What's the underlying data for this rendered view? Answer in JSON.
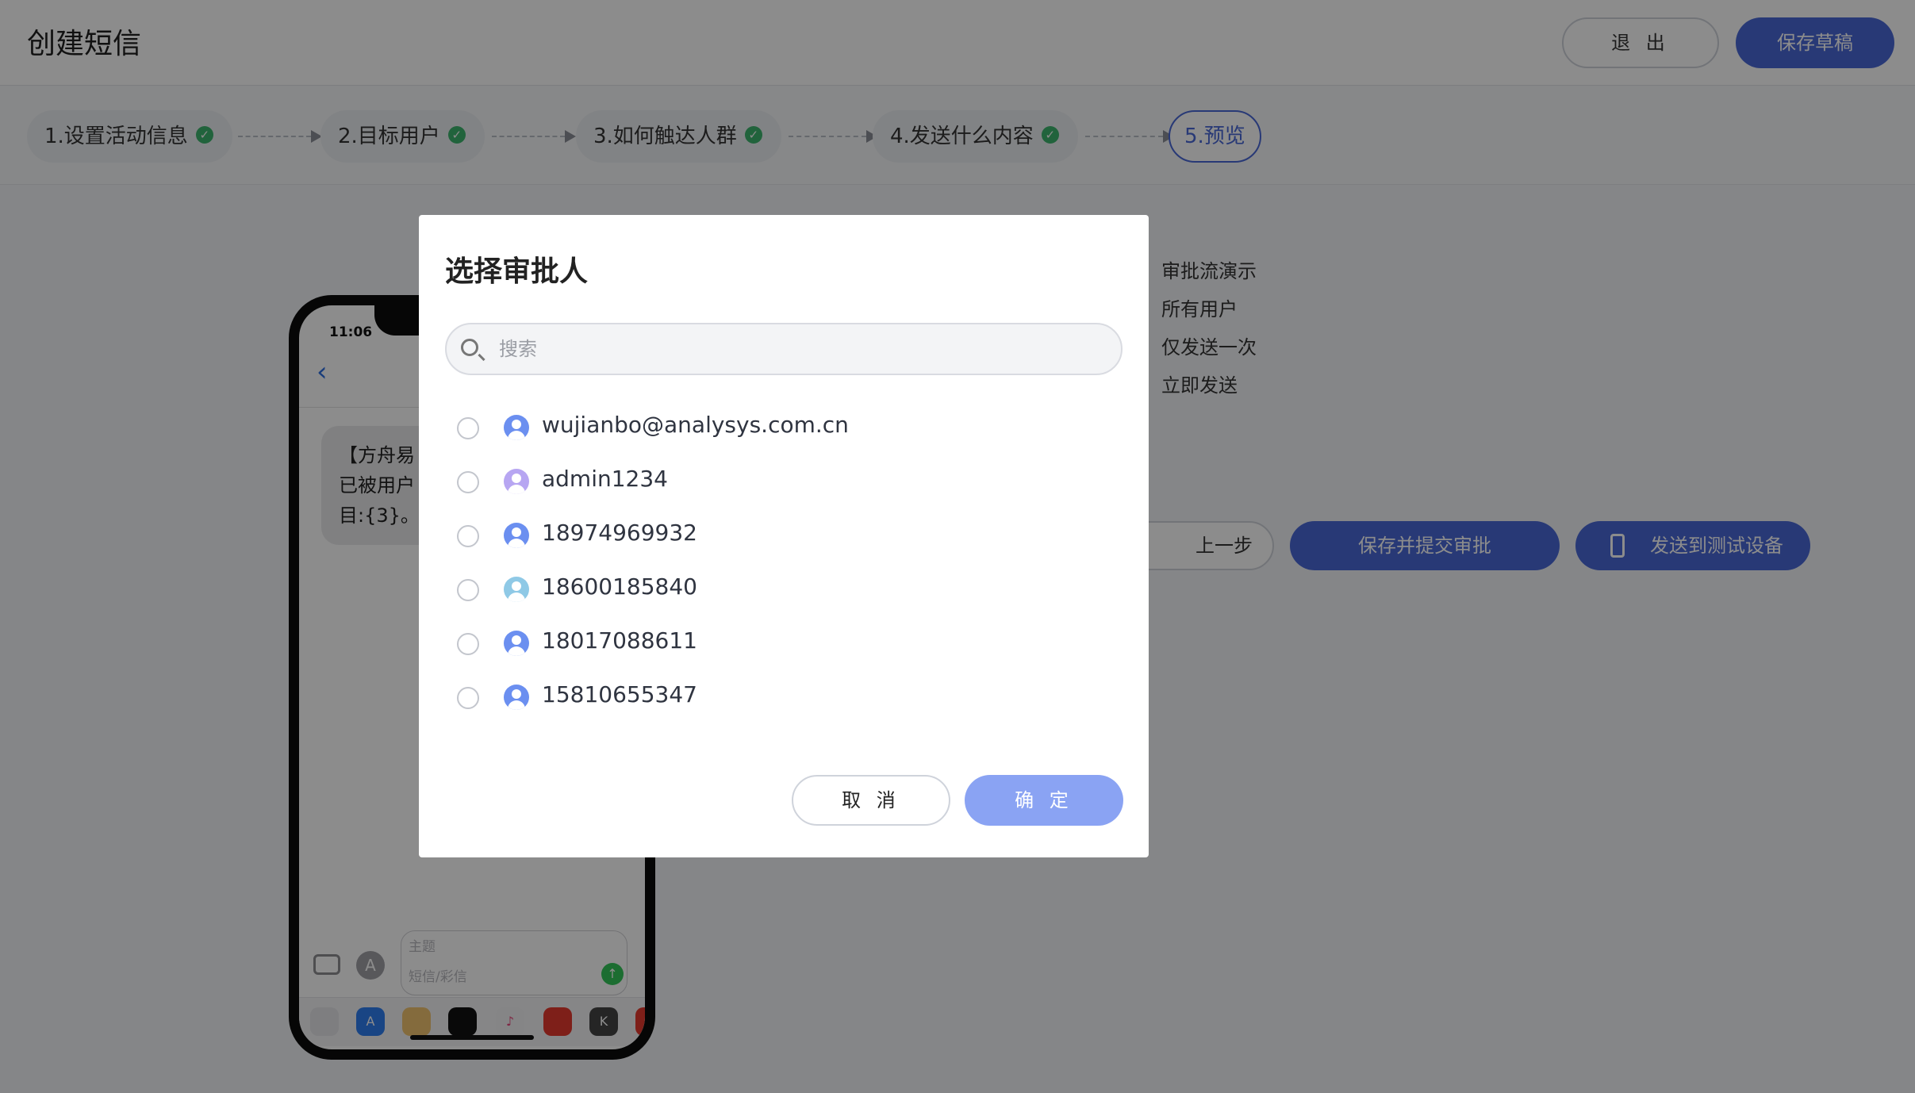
{
  "header": {
    "title": "创建短信",
    "exit_label": "退 出",
    "draft_label": "保存草稿"
  },
  "steps": [
    {
      "label": "1.设置活动信息",
      "done": true
    },
    {
      "label": "2.目标用户",
      "done": true
    },
    {
      "label": "3.如何触达人群",
      "done": true
    },
    {
      "label": "4.发送什么内容",
      "done": true
    },
    {
      "label": "5.预览",
      "done": false,
      "active": true
    }
  ],
  "phone": {
    "time": "11:06",
    "message_lines": [
      "【方舟易",
      "已被用户",
      "目:{3}。"
    ],
    "subject_placeholder": "主题",
    "sms_placeholder": "短信/彩信"
  },
  "summary": {
    "lines": [
      "审批流演示",
      "所有用户",
      "仅发送一次",
      "立即发送"
    ]
  },
  "actions": {
    "prev_label": "上一步",
    "submit_label": "保存并提交审批",
    "test_label": "发送到测试设备"
  },
  "modal": {
    "title": "选择审批人",
    "search_placeholder": "搜索",
    "approvers": [
      {
        "name": "wujianbo@analysys.com.cn",
        "avatar_color": "#6b8ff0"
      },
      {
        "name": "admin1234",
        "avatar_color": "#b7a6f2"
      },
      {
        "name": "18974969932",
        "avatar_color": "#6b8ff0"
      },
      {
        "name": "18600185840",
        "avatar_color": "#8fc9e6"
      },
      {
        "name": "18017088611",
        "avatar_color": "#6b8ff0"
      },
      {
        "name": "15810655347",
        "avatar_color": "#6b8ff0"
      },
      {
        "name": "",
        "avatar_color": "#a78bef"
      }
    ],
    "cancel_label": "取 消",
    "confirm_label": "确 定"
  },
  "colors": {
    "primary": "#4a69d8",
    "primary_light": "#8aa3f3",
    "success": "#3db46d"
  }
}
